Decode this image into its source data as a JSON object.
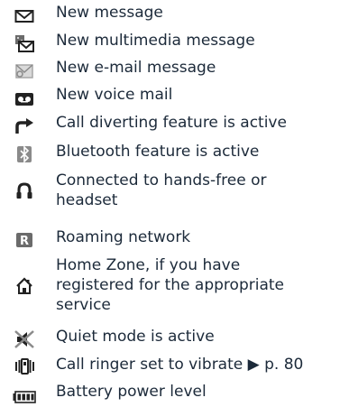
{
  "colors": {
    "text": "#1c2a3a",
    "icon_dark": "#222222",
    "icon_grey": "#6b6b6b",
    "icon_light": "#a6a6a6"
  },
  "items": [
    {
      "icon": "envelope-icon",
      "lines": [
        "New message"
      ]
    },
    {
      "icon": "multimedia-message-icon",
      "lines": [
        "New multimedia message"
      ]
    },
    {
      "icon": "email-message-icon",
      "lines": [
        "New e-mail message"
      ]
    },
    {
      "icon": "voicemail-icon",
      "lines": [
        "New voice mail"
      ]
    },
    {
      "icon": "call-divert-icon",
      "lines": [
        "Call diverting feature is active"
      ]
    },
    {
      "icon": "bluetooth-icon",
      "lines": [
        "Bluetooth feature is active"
      ]
    },
    {
      "icon": "headset-icon",
      "lines": [
        "Connected to hands-free or",
        "headset"
      ]
    },
    {
      "icon": "roaming-icon",
      "lines": [
        "Roaming network"
      ]
    },
    {
      "icon": "home-zone-icon",
      "lines": [
        "Home Zone, if you have",
        " registered for the appropriate",
        "service"
      ]
    },
    {
      "icon": "quiet-mode-icon",
      "lines": [
        "Quiet mode is active"
      ]
    },
    {
      "icon": "vibrate-icon",
      "lines": [
        "Call ringer set to vibrate ▶ p. 80"
      ]
    },
    {
      "icon": "battery-icon",
      "lines": [
        "Battery power level"
      ]
    }
  ]
}
